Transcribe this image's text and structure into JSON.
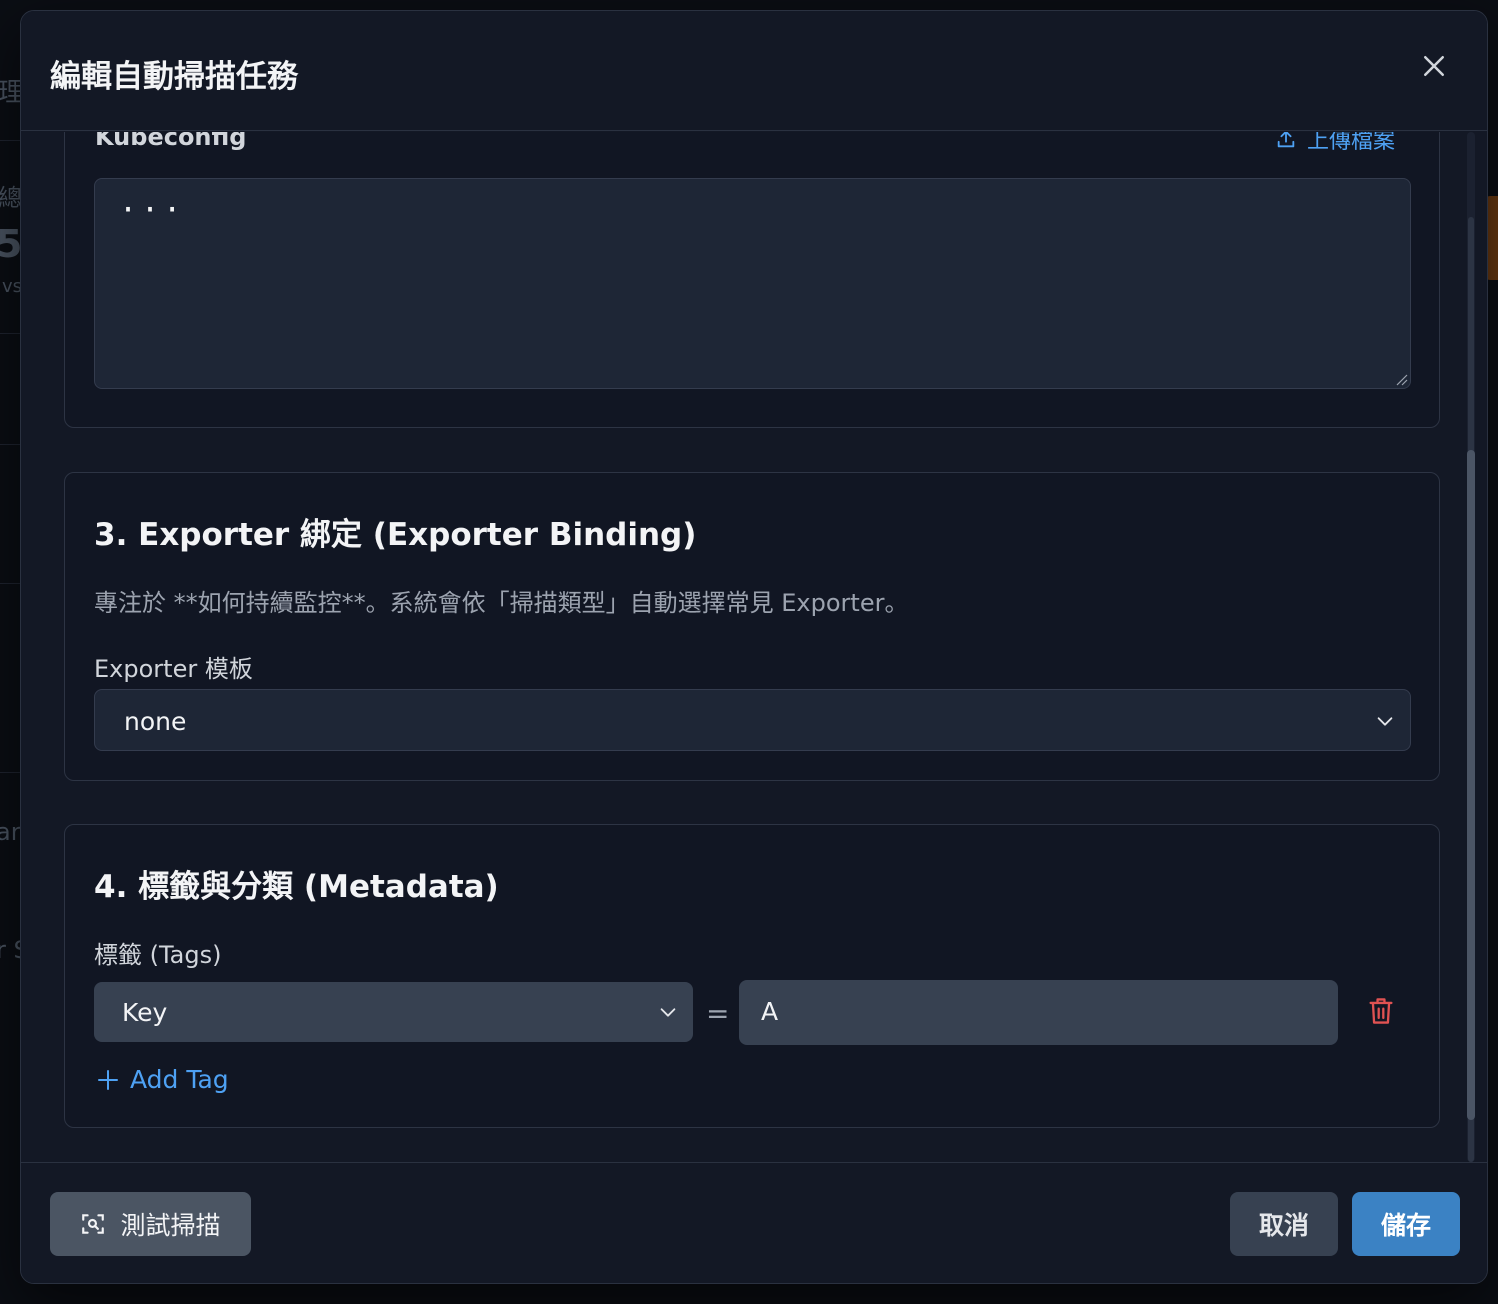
{
  "modal": {
    "title": "編輯自動掃描任務"
  },
  "background_fragments": [
    "理",
    "總",
    "5",
    "vs",
    "ar",
    "r S"
  ],
  "kubeconfig": {
    "label": "Kubeconfig",
    "upload_label": "上傳檔案",
    "value": "···"
  },
  "exporter": {
    "title": "3. Exporter 綁定 (Exporter Binding)",
    "description": "專注於 **如何持續監控**。系統會依「掃描類型」自動選擇常見 Exporter。",
    "template_label": "Exporter 模板",
    "template_value": "none"
  },
  "metadata": {
    "title": "4. 標籤與分類 (Metadata)",
    "tags_label": "標籤 (Tags)",
    "tags": [
      {
        "key": "Key",
        "value": "A"
      }
    ],
    "equals": "=",
    "add_tag_label": "Add Tag"
  },
  "footer": {
    "test_scan_label": "測試掃描",
    "cancel_label": "取消",
    "save_label": "儲存"
  },
  "colors": {
    "accent": "#4ea1f3",
    "save_button": "#3b82c4",
    "danger": "#e05252"
  }
}
